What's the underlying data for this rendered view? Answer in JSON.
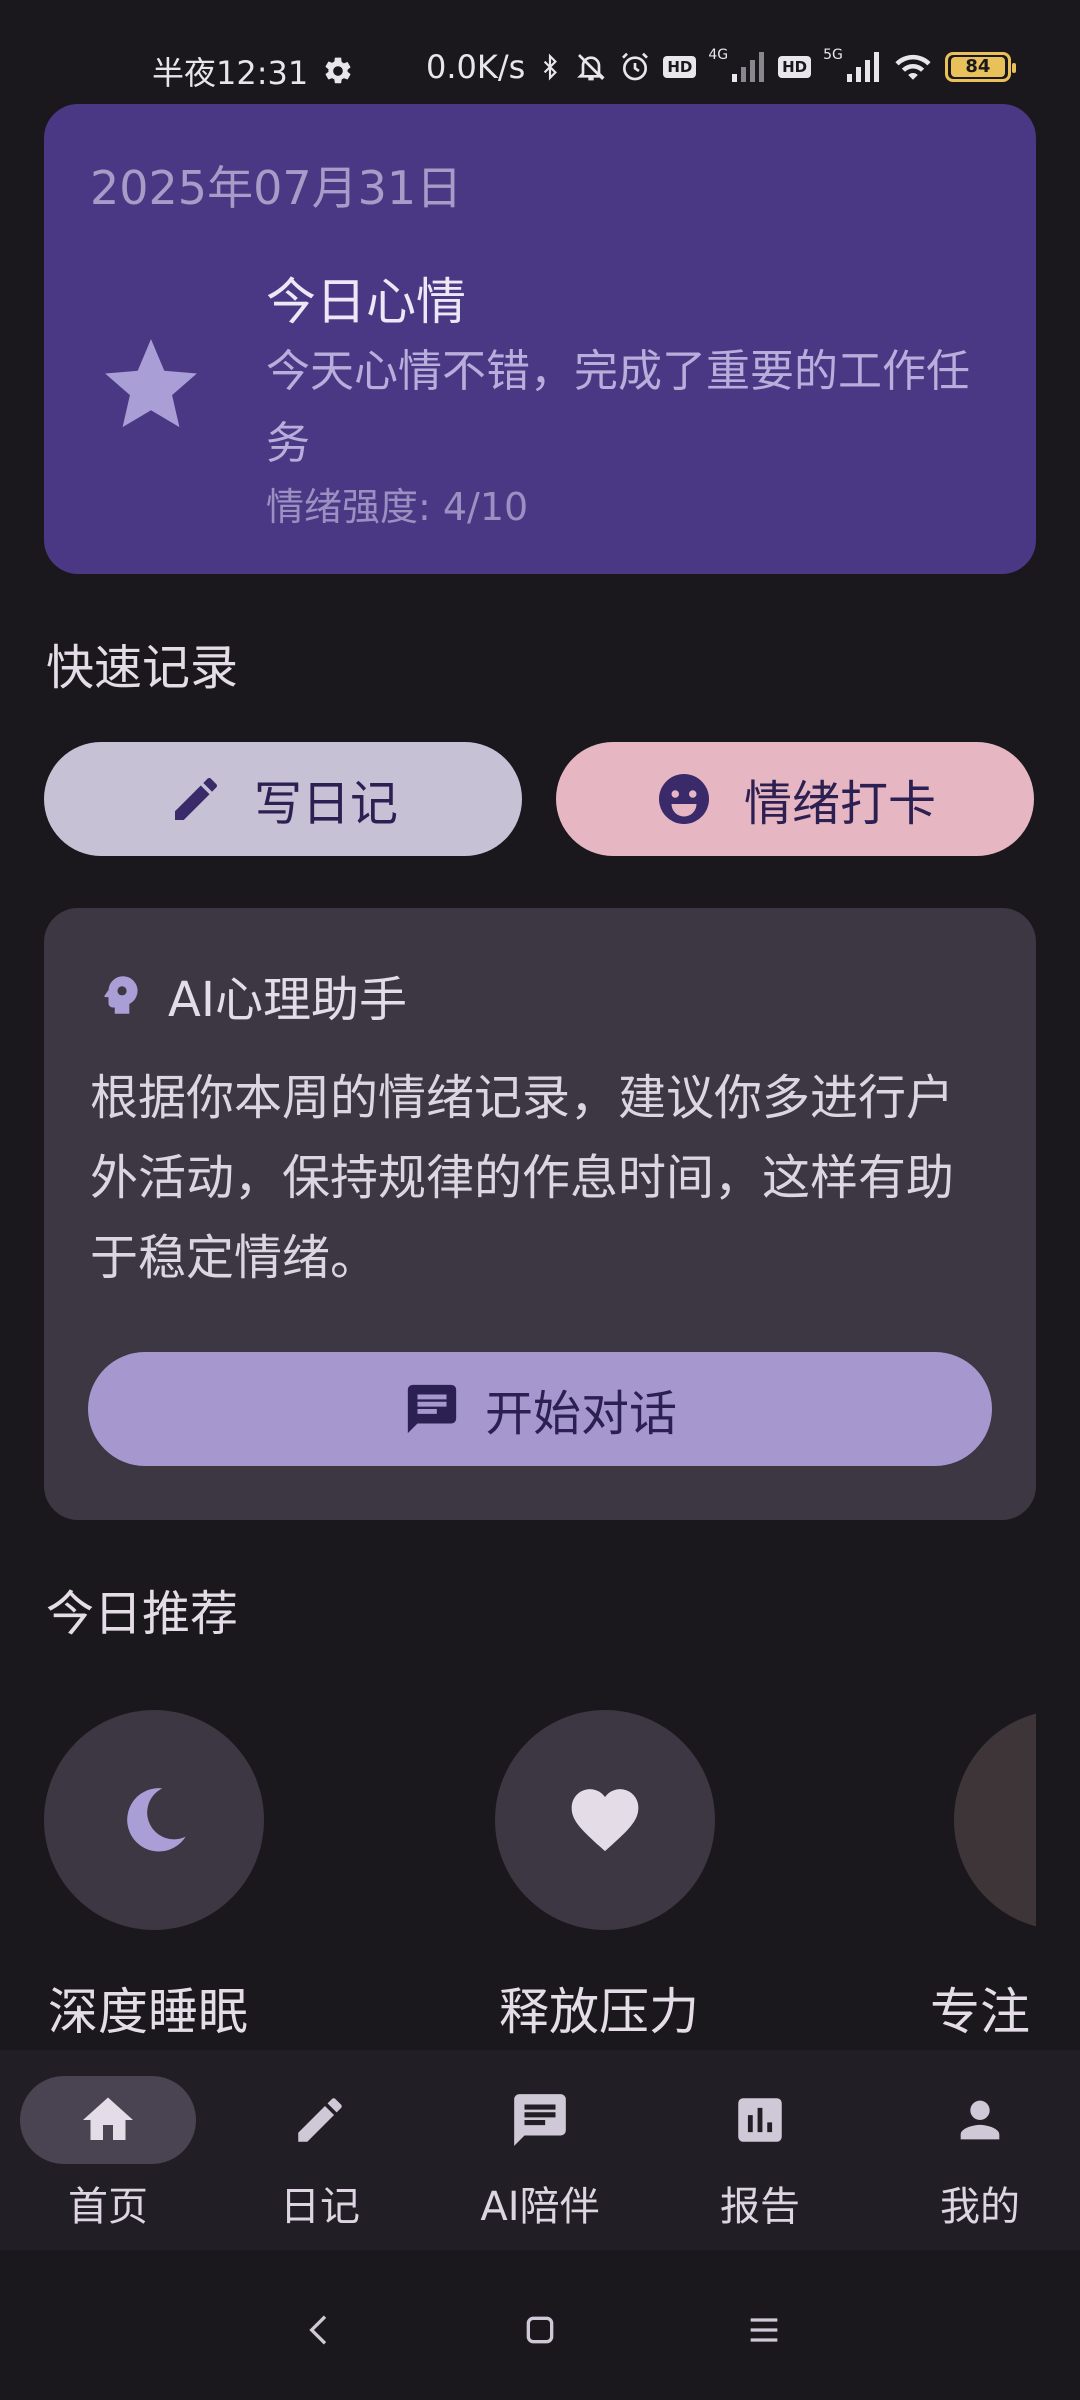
{
  "status_bar": {
    "time": "半夜12:31",
    "net_speed": "0.0K/s",
    "hd1": "HD",
    "net1": "4G",
    "hd2": "HD",
    "net2": "5G",
    "battery": "84"
  },
  "mood_card": {
    "date": "2025年07月31日",
    "title": "今日心情",
    "description": "今天心情不错，完成了重要的工作任务",
    "intensity": "情绪强度: 4/10",
    "icon": "star-icon"
  },
  "quick_record": {
    "title": "快速记录",
    "diary_label": "写日记",
    "checkin_label": "情绪打卡"
  },
  "ai_card": {
    "title": "AI心理助手",
    "body": "根据你本周的情绪记录，建议你多进行户外活动，保持规律的作息时间，这样有助于稳定情绪。",
    "button_label": "开始对话"
  },
  "recommendations": {
    "title": "今日推荐",
    "items": [
      {
        "label": "深度睡眠",
        "icon": "moon-icon"
      },
      {
        "label": "释放压力",
        "icon": "heart-icon"
      },
      {
        "label": "专注",
        "icon": "focus-icon"
      }
    ]
  },
  "bottom_nav": {
    "items": [
      {
        "label": "首页",
        "icon": "home-icon",
        "active": true
      },
      {
        "label": "日记",
        "icon": "pencil-icon",
        "active": false
      },
      {
        "label": "AI陪伴",
        "icon": "chat-icon",
        "active": false
      },
      {
        "label": "报告",
        "icon": "report-icon",
        "active": false
      },
      {
        "label": "我的",
        "icon": "person-icon",
        "active": false
      }
    ]
  },
  "colors": {
    "background": "#1a181d",
    "mood_card": "#4a3884",
    "diary_button": "#c7c1d6",
    "checkin_button": "#e6b6c2",
    "ai_card": "#3c3742",
    "ai_button": "#a698cf",
    "nav_background": "#211f25",
    "battery": "#e8c15a"
  }
}
